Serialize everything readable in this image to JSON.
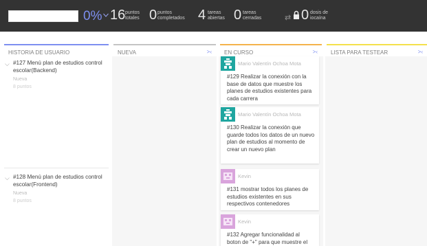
{
  "stats": {
    "progress_percent": "0%",
    "progress_fraction": 0,
    "total_points": {
      "value": "16",
      "label1": "puntos",
      "label2": "totales"
    },
    "completed_points": {
      "value": "0",
      "label1": "puntos",
      "label2": "completados"
    },
    "open_tasks": {
      "value": "4",
      "label1": "tareas",
      "label2": "abiertas"
    },
    "closed_tasks": {
      "value": "0",
      "label1": "tareas",
      "label2": "cerradas"
    },
    "iocaine": {
      "value": "0",
      "label1": "dosis de",
      "label2": "iocaína"
    },
    "swap_icon": "⇄"
  },
  "columns": [
    {
      "name": "HISTORIA DE USUARIO",
      "color": "#7d8ff0"
    },
    {
      "name": "NUEVA",
      "color": "#c4c4c4",
      "collapse": ">‹"
    },
    {
      "name": "EN CURSO",
      "color": "#f4b24b",
      "collapse": ">‹"
    },
    {
      "name": "LISTA PARA TESTEAR",
      "color": "#f4e14b",
      "collapse": ">‹"
    }
  ],
  "stories": [
    {
      "ref": "#127",
      "title": "#127 Menú plan de estudios control escolar(Backend)",
      "status": "Nueva",
      "points": "8 puntos",
      "toggle": "⌵"
    },
    {
      "ref": "#128",
      "title": "#128 Menú plan de estudios control escolar(Frontend)",
      "status": "Nueva",
      "points": "8 puntos",
      "toggle": "⌵"
    }
  ],
  "tasks": [
    {
      "assignee": "Mario Valentín Ochoa Mota",
      "text": "#129 Realizar la conexión con la base de datos que muestre los planes de estudios existentes para cada carrera",
      "avatar_color": "#1fa6a0"
    },
    {
      "assignee": "Mario Valentín Ochoa Mota",
      "text": "#130 Realizar la conexión que guarde todos los datos de un nuevo plan de estudios al momento de crear un nuevo plan",
      "avatar_color": "#1fa6a0"
    },
    {
      "assignee": "Kevin",
      "text": "#131 mostrar todos los planes de estudios existentes en sus respectivos contenedores",
      "avatar_color": "#d9a4dc"
    },
    {
      "assignee": "Kevin",
      "text": "#132 Agregar funcionalidad al boton de \"+\" para que muestre el",
      "avatar_color": "#d9a4dc"
    }
  ]
}
